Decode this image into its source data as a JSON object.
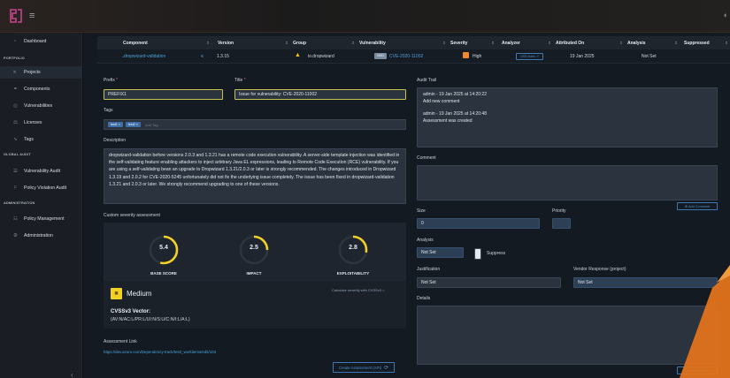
{
  "sidebar": {
    "items": [
      {
        "label": "Dashboard",
        "icon": "dashboard-icon"
      },
      {
        "label": "Projects",
        "icon": "projects-icon"
      },
      {
        "label": "Components",
        "icon": "components-icon"
      },
      {
        "label": "Vulnerabilities",
        "icon": "vulnerabilities-icon"
      },
      {
        "label": "Licenses",
        "icon": "licenses-icon"
      },
      {
        "label": "Tags",
        "icon": "tags-icon"
      },
      {
        "label": "Vulnerability Audit",
        "icon": "audit-icon"
      },
      {
        "label": "Policy Violation Audit",
        "icon": "policy-violation-icon"
      },
      {
        "label": "Policy Management",
        "icon": "policy-management-icon"
      },
      {
        "label": "Administration",
        "icon": "administration-icon"
      }
    ],
    "headings": [
      "PORTFOLIO",
      "GLOBAL AUDIT",
      "ADMINISTRATION"
    ]
  },
  "table": {
    "headers": [
      "Component",
      "Version",
      "Group",
      "Vulnerability",
      "Severity",
      "Analyzer",
      "Attributed On",
      "Analysis",
      "Suppressed"
    ],
    "row": {
      "component": "dropwizard-validation",
      "version": "1.3.15",
      "group": "io.dropwizard",
      "vuln_source": "NVD",
      "vulnerability": "CVE-2020-11002",
      "severity": "High",
      "analyzer": "OSS Index",
      "attributed_on": "19 Jan 2025",
      "analysis": "Not Set"
    }
  },
  "form": {
    "prefix_label": "Prefix",
    "prefix_value": "PREFIX1",
    "title_label": "Title",
    "title_value": "Issue for vulnerability: CVE-2020-11002",
    "tags_label": "Tags",
    "tags": [
      "test1",
      "test2"
    ],
    "tags_placeholder": "Add Tag...",
    "description_label": "Description",
    "description": "dropwizard-validation before versions 2.0.3 and 1.3.21 has a remote code execution vulnerability. A server-side template injection was identified in the self-validating feature enabling attackers to inject arbitrary Java EL expressions, leading to Remote Code Execution (RCE) vulnerability. If you are using a self-validating bean an upgrade to Dropwizard 1.3.21/2.0.3 or later is strongly recommended. The changes introduced in Dropwizard 1.3.19 and 2.0.2 for CVE-2020-5245 unfortunately did not fix the underlying issue completely. The issue has been fixed in dropwizard-validation 1.3.21 and 2.0.3 or later. We strongly recommend upgrading to one of these versions.",
    "custom_severity_label": "Custom severity assessment",
    "scores": [
      {
        "label": "BASE SCORE",
        "value": "5.4",
        "fraction": 0.54
      },
      {
        "label": "IMPACT",
        "value": "2.5",
        "fraction": 0.25
      },
      {
        "label": "EXPLOITABILITY",
        "value": "2.8",
        "fraction": 0.28
      }
    ],
    "severity_text": "Medium",
    "calc_link": "Calculate severity with CVSSv3 >",
    "vector_heading": "CVSSv3 Vector:",
    "vector_value": "(AV:N/AC:L/PR:L/UI:N/S:U/C:N/I:L/A:L)",
    "assessment_link_label": "Assessment Link",
    "assessment_link": "https://dev.azure.com/Dependency-track/test/_workitems/edit/103",
    "create_btn": "Create Assessment (API)"
  },
  "audit": {
    "label": "Audit Trail",
    "entries": [
      {
        "meta": "admin - 19 Jan 2025 at 14:20:22",
        "text": "Add new comment"
      },
      {
        "meta": "admin - 19 Jan 2025 at 14:20:48",
        "text": "Assessment was created"
      }
    ],
    "comment_label": "Comment",
    "add_comment_btn": "Add Comment",
    "size_label": "Size",
    "size_value": "0",
    "priority_label": "Priority",
    "analysis_label": "Analysis",
    "analysis_value": "Not Set",
    "suppress_label": "Suppress",
    "justification_label": "Justification",
    "justification_value": "Not Set",
    "vendor_label": "Vendor Response (project)",
    "vendor_value": "Not Set",
    "details_label": "Details",
    "update_btn": "Update Details"
  },
  "colors": {
    "accent": "#4aa3df",
    "severity_high": "#f0882c",
    "severity_medium": "#f2d024",
    "gauge": "#f2d024"
  }
}
